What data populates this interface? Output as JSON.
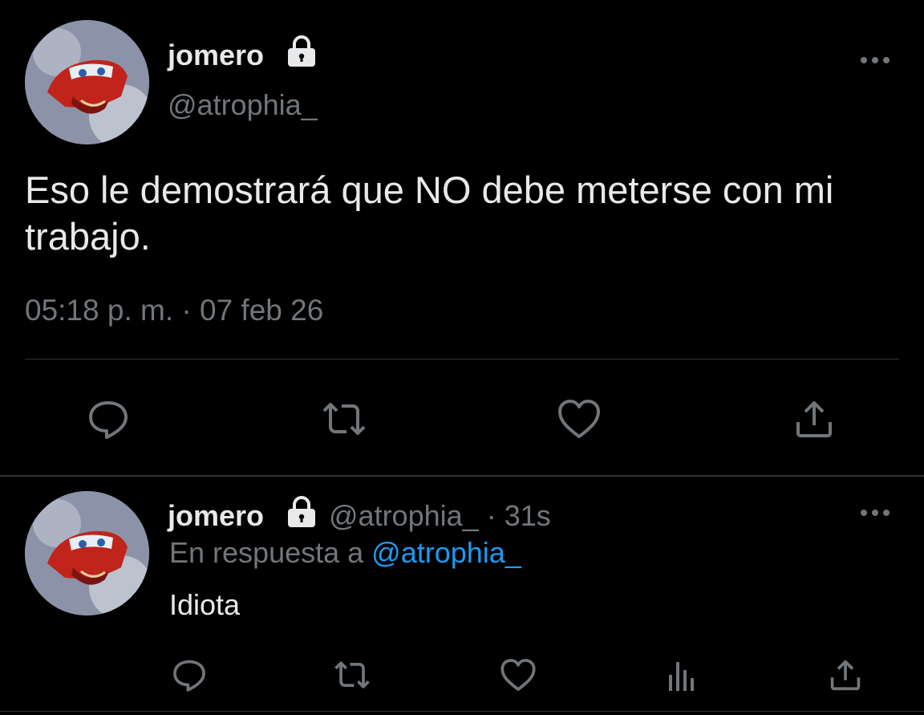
{
  "main_tweet": {
    "display_name": "jomero",
    "handle": "@atrophia_",
    "text": "Eso le demostrará que NO debe meterse con mi trabajo.",
    "timestamp": "05:18 p. m. · 07 feb 26",
    "actions": [
      "reply-icon",
      "retweet-icon",
      "like-icon",
      "share-icon"
    ]
  },
  "reply_tweet": {
    "display_name": "jomero",
    "handle": "@atrophia_",
    "separator": "·",
    "time_ago": "31s",
    "reply_prefix": "En respuesta a",
    "reply_to": "@atrophia_",
    "text": "Idiota",
    "actions": [
      "reply-icon",
      "retweet-icon",
      "like-icon",
      "analytics-icon",
      "share-icon"
    ]
  },
  "colors": {
    "background": "#000000",
    "text": "#e7e9ea",
    "muted": "#71767b",
    "link": "#1d9bf0",
    "divider": "#2f3336"
  }
}
